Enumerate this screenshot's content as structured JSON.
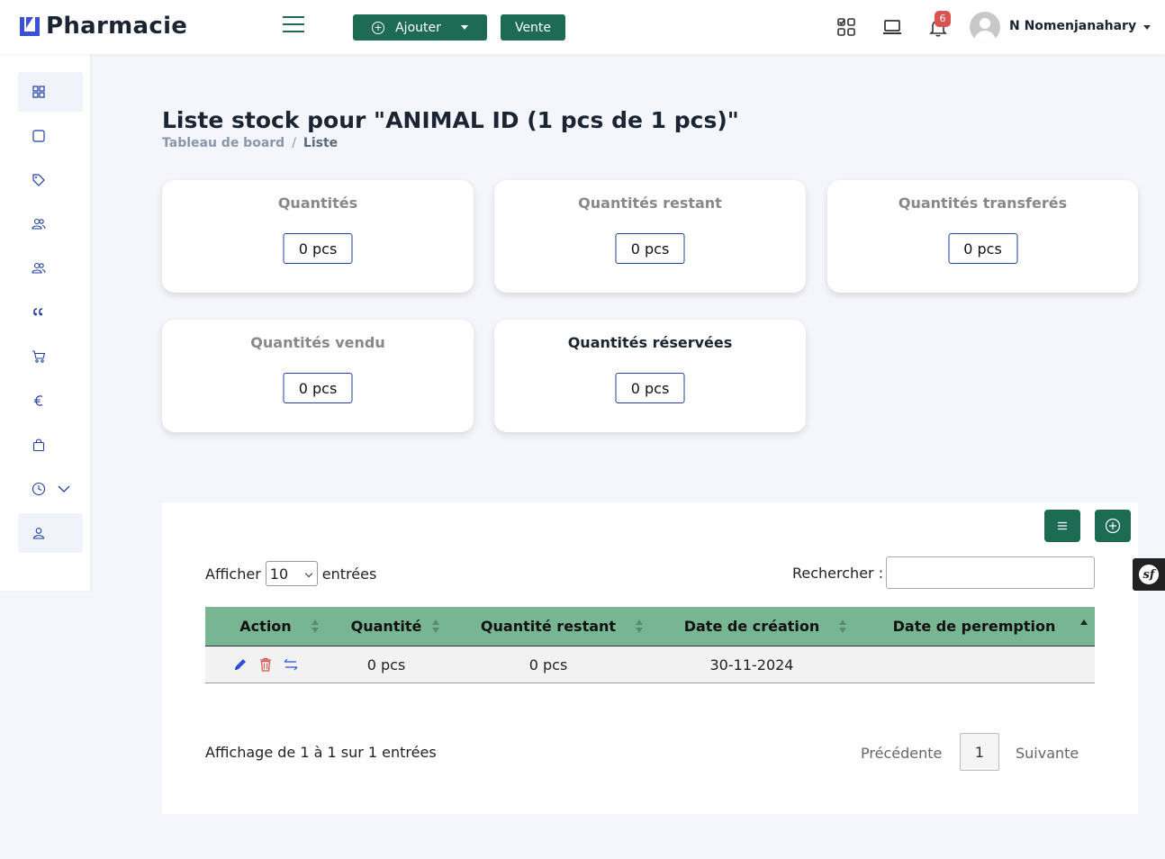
{
  "app": {
    "brand": "Pharmacie"
  },
  "topbar": {
    "add_label": "Ajouter",
    "vente_label": "Vente",
    "notification_count": "6",
    "user_name": "N Nomenjanahary"
  },
  "sidebar": {
    "items": [
      {
        "icon": "grid-icon"
      },
      {
        "icon": "square-icon"
      },
      {
        "icon": "tags-icon"
      },
      {
        "icon": "users-icon"
      },
      {
        "icon": "users-icon"
      },
      {
        "icon": "quote-icon"
      },
      {
        "icon": "cart-icon"
      },
      {
        "icon": "euro-icon"
      },
      {
        "icon": "bag-icon"
      },
      {
        "icon": "clock-icon"
      },
      {
        "icon": "user-icon"
      }
    ]
  },
  "header": {
    "title": "Liste stock pour \"ANIMAL ID (1 pcs de 1 pcs)\"",
    "breadcrumb_home": "Tableau de board",
    "breadcrumb_sep": "/",
    "breadcrumb_current": "Liste"
  },
  "stats": [
    {
      "label": "Quantités",
      "value": "0 pcs"
    },
    {
      "label": "Quantités restant",
      "value": "0 pcs"
    },
    {
      "label": "Quantités transferés",
      "value": "0 pcs"
    },
    {
      "label": "Quantités vendu",
      "value": "0 pcs"
    },
    {
      "label": "Quantités réservées",
      "value": "0 pcs"
    }
  ],
  "table": {
    "length_label_before": "Afficher",
    "length_value": "10",
    "length_label_after": "entrées",
    "search_label": "Rechercher :",
    "search_value": "",
    "columns": [
      "Action",
      "Quantité",
      "Quantité restant",
      "Date de création",
      "Date de peremption"
    ],
    "rows": [
      {
        "quantite": "0 pcs",
        "restant": "0 pcs",
        "creation": "30-11-2024",
        "peremption": ""
      }
    ],
    "info": "Affichage de 1 à 1 sur 1 entrées",
    "prev_label": "Précédente",
    "page": "1",
    "next_label": "Suivante"
  },
  "colors": {
    "primary": "#1d6b52",
    "table_header": "#78b593",
    "edit": "#2b4fd8",
    "delete": "#d9534f",
    "badge": "#d9534f"
  },
  "debug_toolbar": {
    "label": "sf"
  }
}
